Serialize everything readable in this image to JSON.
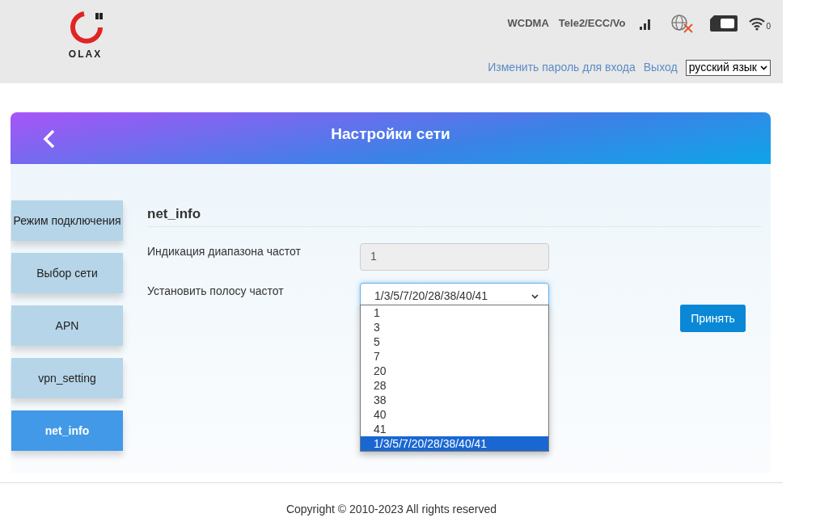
{
  "header": {
    "logo_text": "OLAX",
    "network_type": "WCDMA",
    "operator": "Tele2/ECC/Vo",
    "wifi_clients": "0",
    "links": [
      "Изменить пароль для входа",
      "Выход"
    ],
    "language": {
      "value": "русский язык"
    }
  },
  "panel": {
    "title": "Настройки сети"
  },
  "sidebar": {
    "items": [
      {
        "label": "Режим подключения",
        "selected": false
      },
      {
        "label": "Выбор сети",
        "selected": false
      },
      {
        "label": "APN",
        "selected": false
      },
      {
        "label": "vpn_setting",
        "selected": false
      },
      {
        "label": "net_info",
        "selected": true
      }
    ]
  },
  "content": {
    "heading": "net_info",
    "band_indication": {
      "label": "Индикация диапазона частот",
      "value": "1",
      "disabled": true
    },
    "band_select": {
      "label": "Установить полосу частот",
      "value": "1/3/5/7/20/28/38/40/41",
      "expanded": true,
      "options": [
        {
          "label": "1",
          "selected": false
        },
        {
          "label": "3",
          "selected": false
        },
        {
          "label": "5",
          "selected": false
        },
        {
          "label": "7",
          "selected": false
        },
        {
          "label": "20",
          "selected": false
        },
        {
          "label": "28",
          "selected": false
        },
        {
          "label": "38",
          "selected": false
        },
        {
          "label": "40",
          "selected": false
        },
        {
          "label": "41",
          "selected": false
        },
        {
          "label": "1/3/5/7/20/28/38/40/41",
          "selected": true
        }
      ]
    },
    "apply_button": "Принять"
  },
  "footer": {
    "copyright": "Copyright © 2010-2023 All rights reserved"
  }
}
